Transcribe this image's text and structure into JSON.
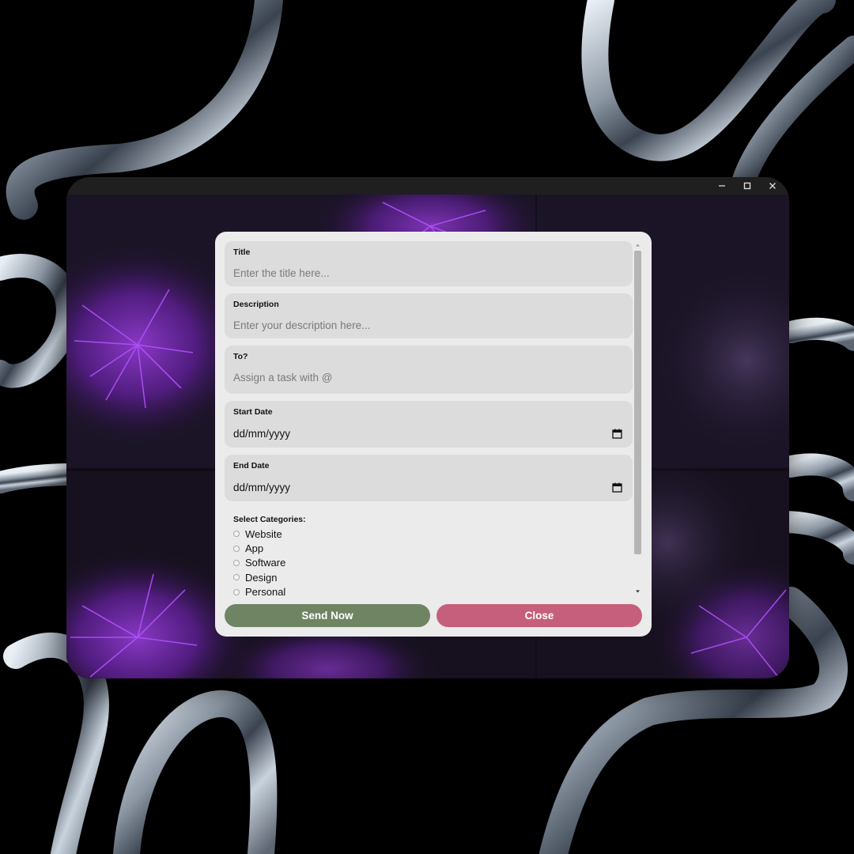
{
  "window_controls": {
    "minimize_icon": "minimize-icon",
    "maximize_icon": "maximize-icon",
    "close_icon": "close-icon"
  },
  "form": {
    "title": {
      "label": "Title",
      "placeholder": "Enter the title here...",
      "value": ""
    },
    "description": {
      "label": "Description",
      "placeholder": "Enter your description here...",
      "value": ""
    },
    "assignee": {
      "label": "To?",
      "placeholder": "Assign a task with @",
      "value": ""
    },
    "start_date": {
      "label": "Start Date",
      "value": "dd/mm/yyyy",
      "icon": "calendar-icon"
    },
    "end_date": {
      "label": "End Date",
      "value": "dd/mm/yyyy",
      "icon": "calendar-icon"
    },
    "categories": {
      "title": "Select Categories:",
      "options": [
        "Website",
        "App",
        "Software",
        "Design",
        "Personal"
      ]
    }
  },
  "buttons": {
    "send_label": "Send Now",
    "close_label": "Close"
  },
  "colors": {
    "dialog_bg": "#ebebeb",
    "field_bg": "#dcdcdc",
    "send_button": "#6f8462",
    "close_button": "#c65f7b",
    "titlebar": "#1f1f1f"
  }
}
